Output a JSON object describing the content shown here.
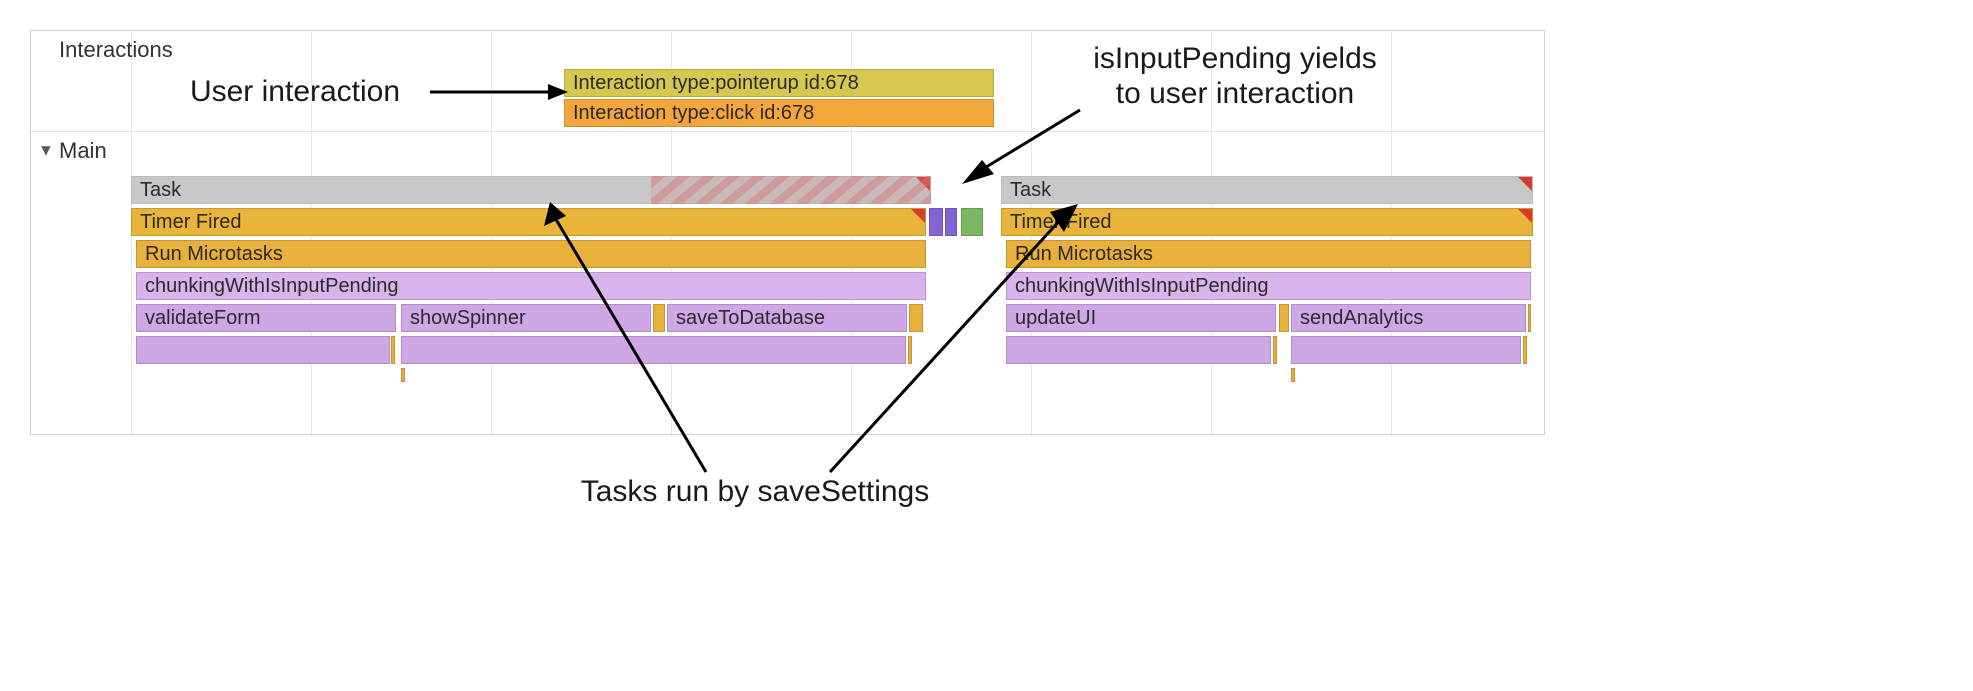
{
  "sections": {
    "interactions_label": "Interactions",
    "main_label": "Main"
  },
  "interactions": {
    "bar1": "Interaction type:pointerup id:678",
    "bar2": "Interaction type:click id:678"
  },
  "main": {
    "task1": "Task",
    "task2": "Task",
    "timer1": "Timer Fired",
    "timer2": "Timer Fired",
    "micro1": "Run Microtasks",
    "micro2": "Run Microtasks",
    "chunk1": "chunkingWithIsInputPending",
    "chunk2": "chunkingWithIsInputPending",
    "fn_validateForm": "validateForm",
    "fn_showSpinner": "showSpinner",
    "fn_saveToDatabase": "saveToDatabase",
    "fn_updateUI": "updateUI",
    "fn_sendAnalytics": "sendAnalytics"
  },
  "annotations": {
    "user_interaction": "User interaction",
    "is_input_pending_line1": "isInputPending yields",
    "is_input_pending_line2": "to user interaction",
    "tasks_run_by": "Tasks run by saveSettings"
  }
}
